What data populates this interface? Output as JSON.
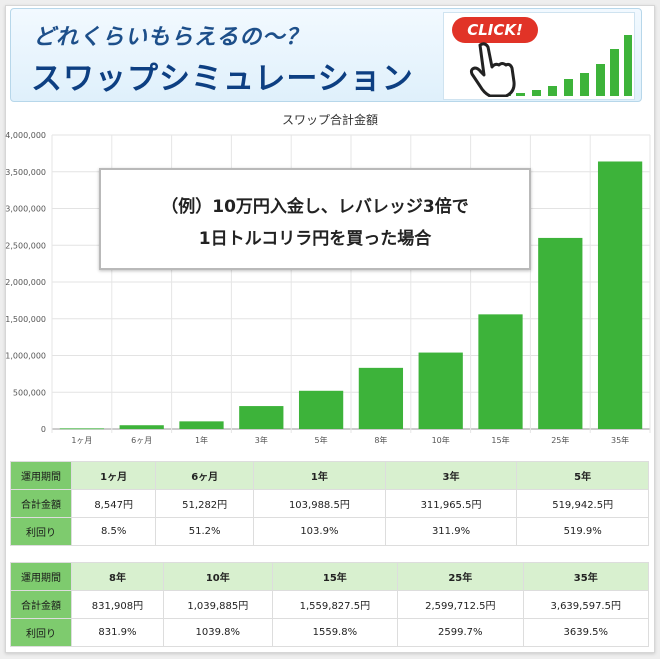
{
  "banner": {
    "subtitle": "どれくらいもらえるの〜？",
    "title": "スワップシミュレーション",
    "click_label": "CLICK!"
  },
  "overlay": {
    "line1": "（例）10万円入金し、レバレッジ3倍で",
    "line2": "1日トルコリラ円を買った場合"
  },
  "chart_data": {
    "type": "bar",
    "title": "スワップ合計金額",
    "categories": [
      "1ヶ月",
      "6ヶ月",
      "1年",
      "3年",
      "5年",
      "8年",
      "10年",
      "15年",
      "25年",
      "35年"
    ],
    "values": [
      8547,
      51282,
      103988.5,
      311965.5,
      519942.5,
      831908,
      1039885,
      1559827.5,
      2599712.5,
      3639597.5
    ],
    "ylim": [
      0,
      4000000
    ],
    "yticks": [
      "0",
      "500,000",
      "1,000,000",
      "1,500,000",
      "2,000,000",
      "2,500,000",
      "3,000,000",
      "3,500,000",
      "4,000,000"
    ],
    "grid": true,
    "bar_color": "#3db33a"
  },
  "table1": {
    "row_labels": [
      "運用期間",
      "合計金額",
      "利回り"
    ],
    "periods": [
      "1ヶ月",
      "6ヶ月",
      "1年",
      "3年",
      "5年"
    ],
    "totals": [
      "8,547円",
      "51,282円",
      "103,988.5円",
      "311,965.5円",
      "519,942.5円"
    ],
    "yields": [
      "8.5%",
      "51.2%",
      "103.9%",
      "311.9%",
      "519.9%"
    ]
  },
  "table2": {
    "row_labels": [
      "運用期間",
      "合計金額",
      "利回り"
    ],
    "periods": [
      "8年",
      "10年",
      "15年",
      "25年",
      "35年"
    ],
    "totals": [
      "831,908円",
      "1,039,885円",
      "1,559,827.5円",
      "2,599,712.5円",
      "3,639,597.5円"
    ],
    "yields": [
      "831.9%",
      "1039.8%",
      "1559.8%",
      "2599.7%",
      "3639.5%"
    ]
  }
}
